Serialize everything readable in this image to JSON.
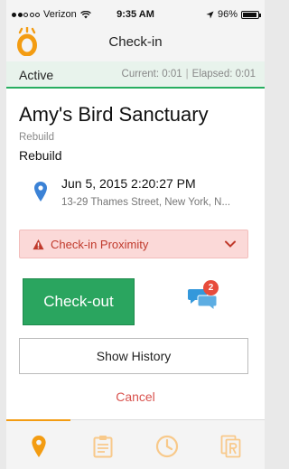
{
  "status_bar": {
    "carrier": "Verizon",
    "time": "9:35 AM",
    "battery": "96%",
    "battery_level": 0.96
  },
  "nav": {
    "title": "Check-in"
  },
  "active_bar": {
    "label": "Active",
    "current": "Current: 0:01",
    "separator": "|",
    "elapsed": "Elapsed: 0:01"
  },
  "site": {
    "name": "Amy's Bird Sanctuary",
    "subtitle": "Rebuild",
    "task": "Rebuild"
  },
  "checkin": {
    "datetime": "Jun 5, 2015 2:20:27 PM",
    "address": "13-29 Thames Street, New York, N..."
  },
  "proximity": {
    "label": "Check-in Proximity"
  },
  "actions": {
    "checkout_label": "Check-out",
    "chat_badge": "2",
    "history_label": "Show History",
    "cancel_label": "Cancel"
  },
  "tabs": [
    {
      "icon": "location-pin-icon",
      "active": true
    },
    {
      "icon": "clipboard-icon",
      "active": false
    },
    {
      "icon": "clock-icon",
      "active": false
    },
    {
      "icon": "document-r-icon",
      "active": false
    }
  ],
  "colors": {
    "accent": "#f39c12",
    "success": "#2aa55f",
    "danger": "#c0392b",
    "pin_blue": "#3b82d6",
    "chat_blue": "#3498db"
  }
}
